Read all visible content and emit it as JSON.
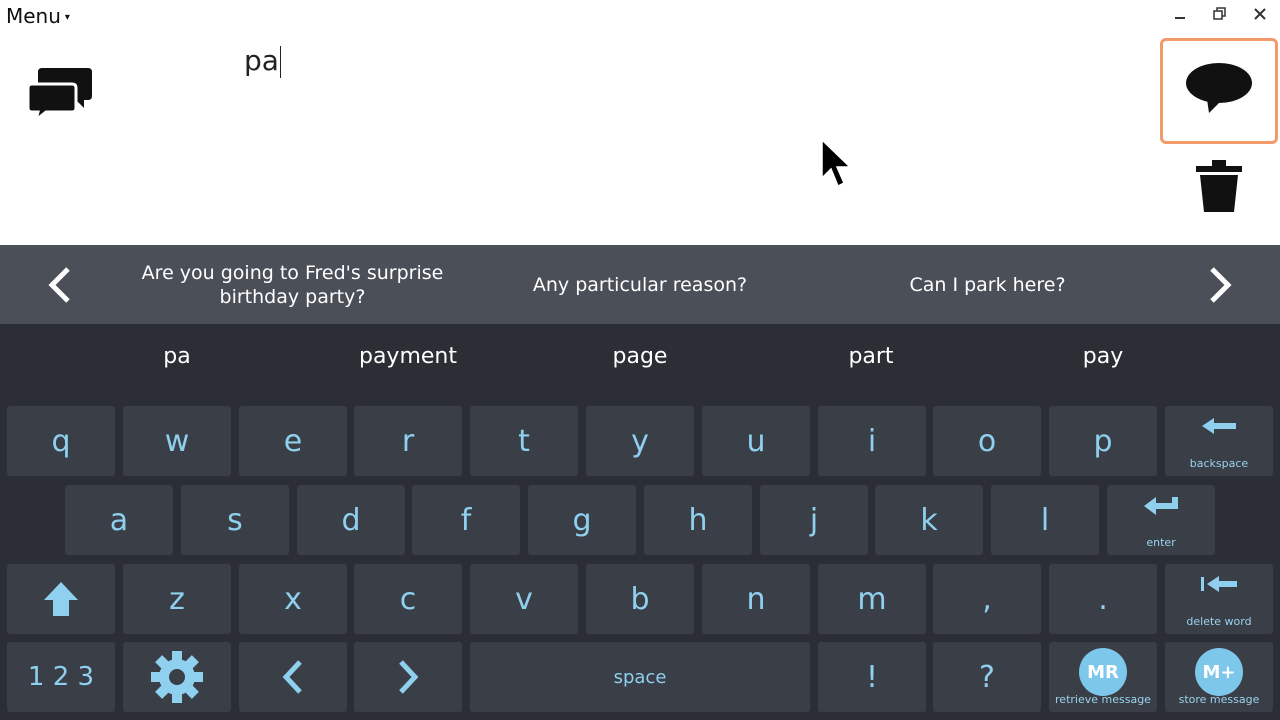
{
  "window": {
    "menu_label": "Menu",
    "menu_caret": "▾"
  },
  "message": {
    "text": "pa"
  },
  "phrases": [
    "Are you going to Fred's surprise birthday party?",
    "Any particular reason?",
    "Can I park here?"
  ],
  "predictions": [
    "pa",
    "payment",
    "page",
    "part",
    "pay"
  ],
  "keyboard": {
    "row1": [
      "q",
      "w",
      "e",
      "r",
      "t",
      "y",
      "u",
      "i",
      "o",
      "p"
    ],
    "row2": [
      "a",
      "s",
      "d",
      "f",
      "g",
      "h",
      "j",
      "k",
      "l"
    ],
    "row3": [
      "z",
      "x",
      "c",
      "v",
      "b",
      "n",
      "m",
      ",",
      "."
    ],
    "backspace_label": "backspace",
    "enter_label": "enter",
    "delete_word_label": "delete word",
    "numbers_label": "1 2 3",
    "space_label": "space",
    "exclaim_label": "!",
    "question_label": "?",
    "mr_badge": "MR",
    "mr_label": "retrieve message",
    "mplus_badge": "M+",
    "mplus_label": "store message"
  },
  "colors": {
    "accent": "#8fd0ef",
    "highlight_border": "#f39a6b",
    "phrase_bar": "#4a4f58",
    "keyboard_bg": "#2b2e35",
    "key_bg": "#3a3e47"
  }
}
